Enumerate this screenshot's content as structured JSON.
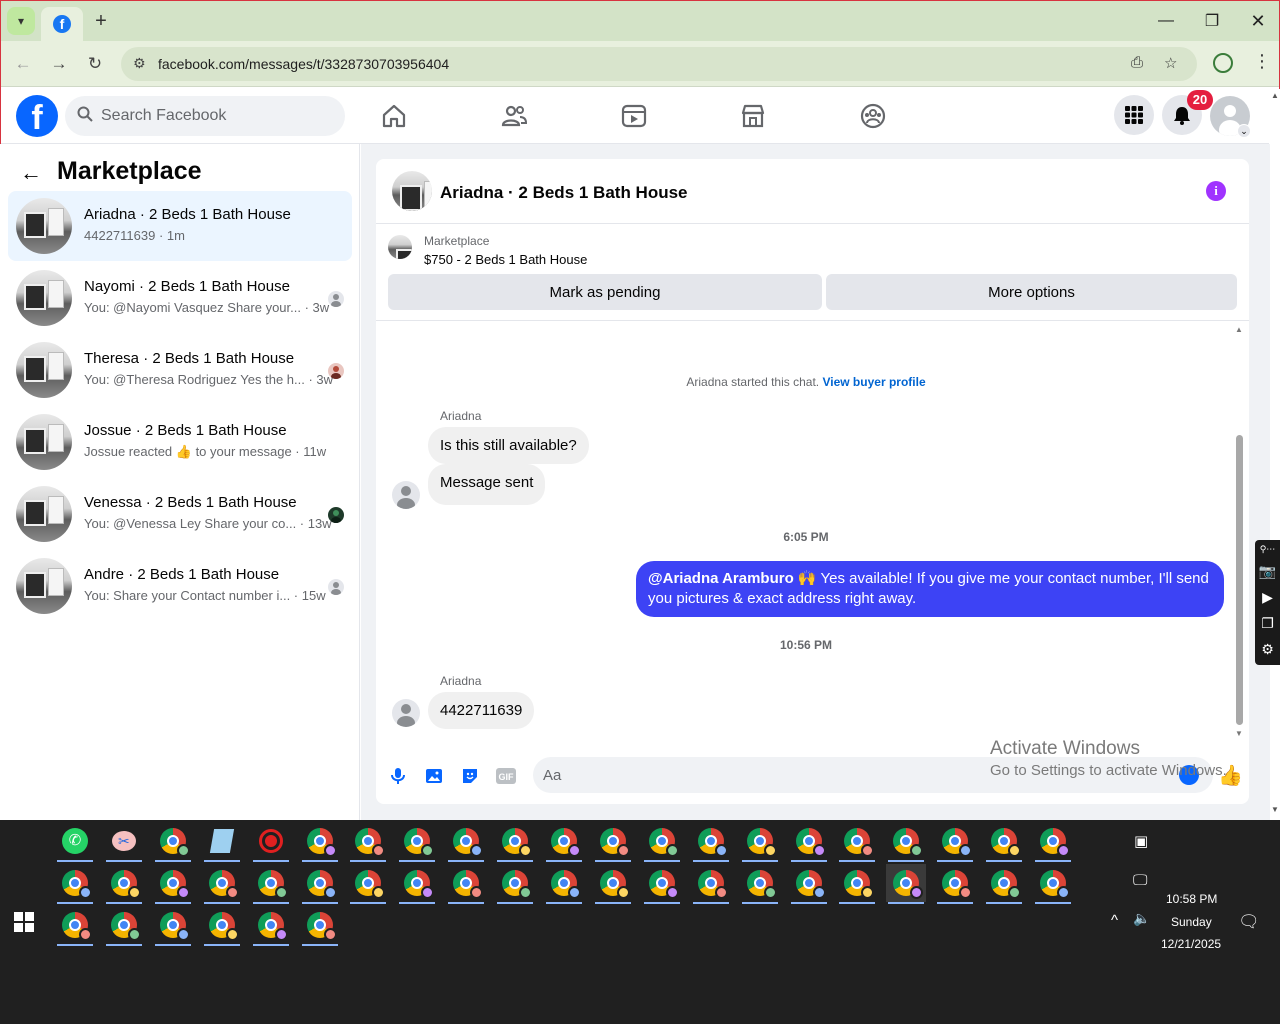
{
  "browser": {
    "url": "facebook.com/messages/t/3328730703956404"
  },
  "fb": {
    "search_placeholder": "Search Facebook",
    "notif_count": "20"
  },
  "left": {
    "title": "Marketplace",
    "conversations": [
      {
        "name": "Ariadna · 2 Beds 1 Bath House",
        "sub": "4422711639 · 1m",
        "active": true
      },
      {
        "name": "Nayomi · 2 Beds 1 Bath House",
        "sub": "You: @Nayomi Vasquez Share your... · 3w"
      },
      {
        "name": "Theresa · 2 Beds 1 Bath House",
        "sub": "You: @Theresa Rodriguez Yes the h... · 3w"
      },
      {
        "name": "Jossue · 2 Beds 1 Bath House",
        "sub": "Jossue reacted 👍 to your message · 11w"
      },
      {
        "name": "Venessa · 2 Beds 1 Bath House",
        "sub": "You: @Venessa Ley Share your co... · 13w"
      },
      {
        "name": "Andre · 2 Beds 1 Bath House",
        "sub": "You: Share your Contact number i... · 15w"
      }
    ]
  },
  "chat": {
    "title": "Ariadna · 2 Beds 1 Bath House",
    "marketplace_label": "Marketplace",
    "listing": "$750 - 2 Beds 1 Bath House",
    "mark_pending": "Mark as pending",
    "more_options": "More options",
    "started": "Ariadna started this chat.",
    "view_buyer": "View buyer profile",
    "sender1": "Ariadna",
    "msg1": "Is this still available?",
    "msg2": "Message sent",
    "time1": "6:05 PM",
    "out_mention": "@Ariadna Aramburo",
    "out_text": " 🙌 Yes available! If you give me your contact number, I'll send you pictures & exact address right away.",
    "time2": "10:56 PM",
    "sender2": "Ariadna",
    "msg3": "4422711639",
    "composer_placeholder": "Aa"
  },
  "watermark": {
    "line1": "Activate Windows",
    "line2": "Go to Settings to activate Windows."
  },
  "clock": {
    "time": "10:58 PM",
    "day": "Sunday",
    "date": "12/21/2025"
  }
}
